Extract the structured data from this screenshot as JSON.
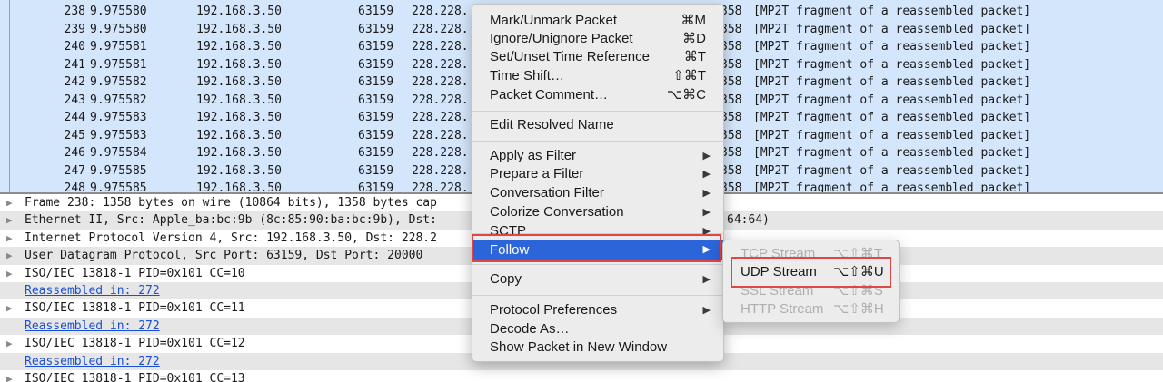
{
  "packets": [
    {
      "no": "238",
      "time": "9.975580",
      "src": "192.168.3.50",
      "port": "63159",
      "dst": "228.228.",
      "len": "358",
      "info": "[MP2T fragment of a reassembled packet]"
    },
    {
      "no": "239",
      "time": "9.975580",
      "src": "192.168.3.50",
      "port": "63159",
      "dst": "228.228.",
      "len": "358",
      "info": "[MP2T fragment of a reassembled packet]"
    },
    {
      "no": "240",
      "time": "9.975581",
      "src": "192.168.3.50",
      "port": "63159",
      "dst": "228.228.",
      "len": "358",
      "info": "[MP2T fragment of a reassembled packet]"
    },
    {
      "no": "241",
      "time": "9.975581",
      "src": "192.168.3.50",
      "port": "63159",
      "dst": "228.228.",
      "len": "358",
      "info": "[MP2T fragment of a reassembled packet]"
    },
    {
      "no": "242",
      "time": "9.975582",
      "src": "192.168.3.50",
      "port": "63159",
      "dst": "228.228.",
      "len": "358",
      "info": "[MP2T fragment of a reassembled packet]"
    },
    {
      "no": "243",
      "time": "9.975582",
      "src": "192.168.3.50",
      "port": "63159",
      "dst": "228.228.",
      "len": "358",
      "info": "[MP2T fragment of a reassembled packet]"
    },
    {
      "no": "244",
      "time": "9.975583",
      "src": "192.168.3.50",
      "port": "63159",
      "dst": "228.228.",
      "len": "358",
      "info": "[MP2T fragment of a reassembled packet]"
    },
    {
      "no": "245",
      "time": "9.975583",
      "src": "192.168.3.50",
      "port": "63159",
      "dst": "228.228.",
      "len": "358",
      "info": "[MP2T fragment of a reassembled packet]"
    },
    {
      "no": "246",
      "time": "9.975584",
      "src": "192.168.3.50",
      "port": "63159",
      "dst": "228.228.",
      "len": "358",
      "info": "[MP2T fragment of a reassembled packet]"
    },
    {
      "no": "247",
      "time": "9.975585",
      "src": "192.168.3.50",
      "port": "63159",
      "dst": "228.228.",
      "len": "358",
      "info": "[MP2T fragment of a reassembled packet]"
    },
    {
      "no": "248",
      "time": "9.975585",
      "src": "192.168.3.50",
      "port": "63159",
      "dst": "228.228.",
      "len": "358",
      "info": "[MP2T fragment of a reassembled packet]"
    }
  ],
  "details": [
    {
      "text": "Frame 238: 1358 bytes on wire (10864 bits), 1358 bytes cap",
      "expand": true,
      "link": false
    },
    {
      "text": "Ethernet II, Src: Apple_ba:bc:9b (8c:85:90:ba:bc:9b), Dst:",
      "tail": "64:64)",
      "expand": true,
      "link": false
    },
    {
      "text": "Internet Protocol Version 4, Src: 192.168.3.50, Dst: 228.2",
      "expand": true,
      "link": false
    },
    {
      "text": "User Datagram Protocol, Src Port: 63159, Dst Port: 20000",
      "expand": true,
      "link": false
    },
    {
      "text": "ISO/IEC 13818-1 PID=0x101 CC=10",
      "expand": true,
      "link": false
    },
    {
      "text": "Reassembled in: 272",
      "expand": false,
      "link": true
    },
    {
      "text": "ISO/IEC 13818-1 PID=0x101 CC=11",
      "expand": true,
      "link": false
    },
    {
      "text": "Reassembled in: 272",
      "expand": false,
      "link": true
    },
    {
      "text": "ISO/IEC 13818-1 PID=0x101 CC=12",
      "expand": true,
      "link": false
    },
    {
      "text": "Reassembled in: 272",
      "expand": false,
      "link": true
    },
    {
      "text": "ISO/IEC 13818-1 PID=0x101 CC=13",
      "expand": true,
      "link": false
    }
  ],
  "menu": {
    "items": [
      {
        "label": "Mark/Unmark Packet",
        "shortcut": "⌘M"
      },
      {
        "label": "Ignore/Unignore Packet",
        "shortcut": "⌘D"
      },
      {
        "label": "Set/Unset Time Reference",
        "shortcut": "⌘T"
      },
      {
        "label": "Time Shift…",
        "shortcut": "⇧⌘T"
      },
      {
        "label": "Packet Comment…",
        "shortcut": "⌥⌘C"
      },
      {
        "label": "Edit Resolved Name"
      },
      {
        "label": "Apply as Filter",
        "submenu": true
      },
      {
        "label": "Prepare a Filter",
        "submenu": true
      },
      {
        "label": "Conversation Filter",
        "submenu": true
      },
      {
        "label": "Colorize Conversation",
        "submenu": true
      },
      {
        "label": "SCTP",
        "submenu": true
      },
      {
        "label": "Follow",
        "submenu": true,
        "highlighted": true
      },
      {
        "label": "Copy",
        "submenu": true
      },
      {
        "label": "Protocol Preferences",
        "submenu": true
      },
      {
        "label": "Decode As…"
      },
      {
        "label": "Show Packet in New Window"
      }
    ]
  },
  "submenu": {
    "items": [
      {
        "label": "TCP Stream",
        "shortcut": "⌥⇧⌘T",
        "enabled": false
      },
      {
        "label": "UDP Stream",
        "shortcut": "⌥⇧⌘U",
        "enabled": true
      },
      {
        "label": "SSL Stream",
        "shortcut": "⌥⇧⌘S",
        "enabled": false
      },
      {
        "label": "HTTP Stream",
        "shortcut": "⌥⇧⌘H",
        "enabled": false
      }
    ]
  },
  "colors": {
    "selection": "#2b65d9",
    "list_bg": "#d4e6fb",
    "link": "#1a4fd6",
    "annotation": "#e04646"
  },
  "icons": {
    "expand": "triangle-right-icon",
    "submenu": "triangle-right-icon"
  }
}
